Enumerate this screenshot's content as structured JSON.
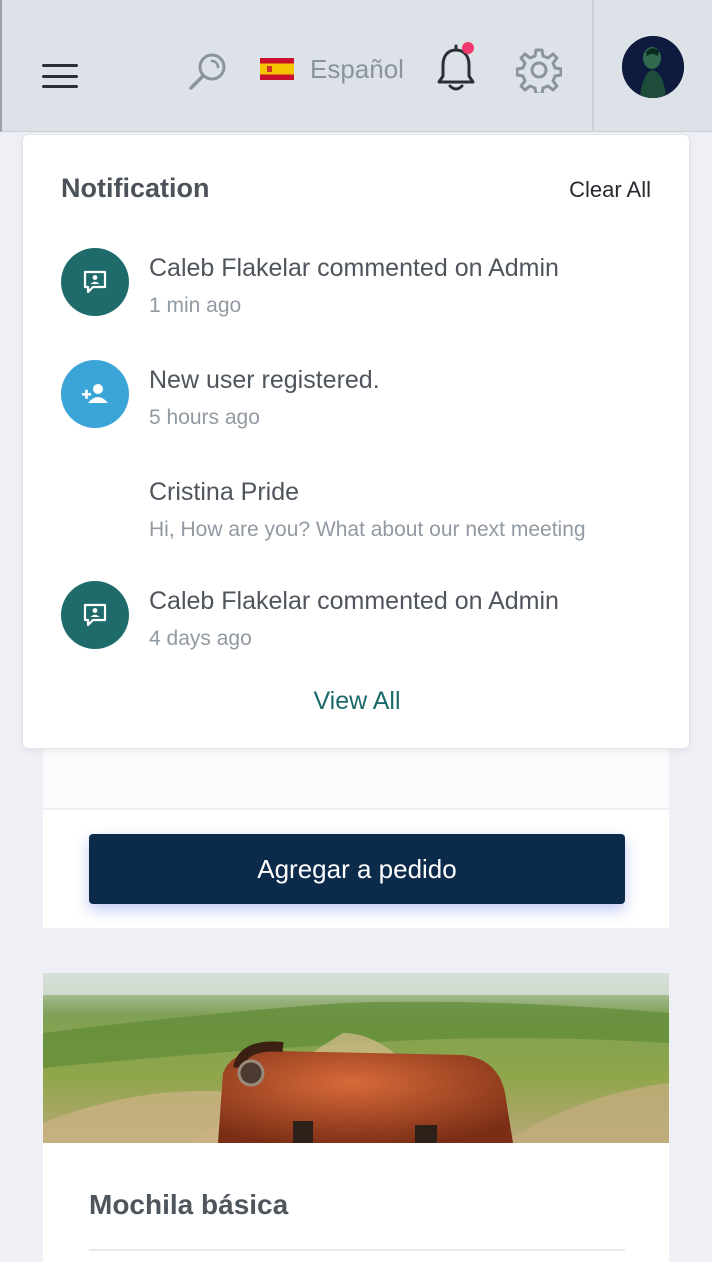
{
  "header": {
    "language_label": "Español",
    "has_unread_notifications": true
  },
  "notifications": {
    "title": "Notification",
    "clear_all_label": "Clear All",
    "items": [
      {
        "icon": "comment-icon",
        "color": "#1f6b6b",
        "title": "Caleb Flakelar commented on Admin",
        "subtitle": "1 min ago"
      },
      {
        "icon": "add-user-icon",
        "color": "#3ba5d8",
        "title": "New user registered.",
        "subtitle": "5 hours ago"
      },
      {
        "icon": "",
        "color": "",
        "title": "Cristina Pride",
        "subtitle": "Hi, How are you? What about our next meeting"
      },
      {
        "icon": "comment-icon",
        "color": "#1f6b6b",
        "title": "Caleb Flakelar commented on Admin",
        "subtitle": "4 days ago"
      }
    ],
    "view_all_label": "View All"
  },
  "page": {
    "order_button_label": "Agregar a pedido",
    "product_title": "Mochila básica"
  },
  "colors": {
    "accent_teal": "#1b6a6a",
    "primary_navy": "#0c2b4b",
    "notification_dot": "#f0386b"
  }
}
